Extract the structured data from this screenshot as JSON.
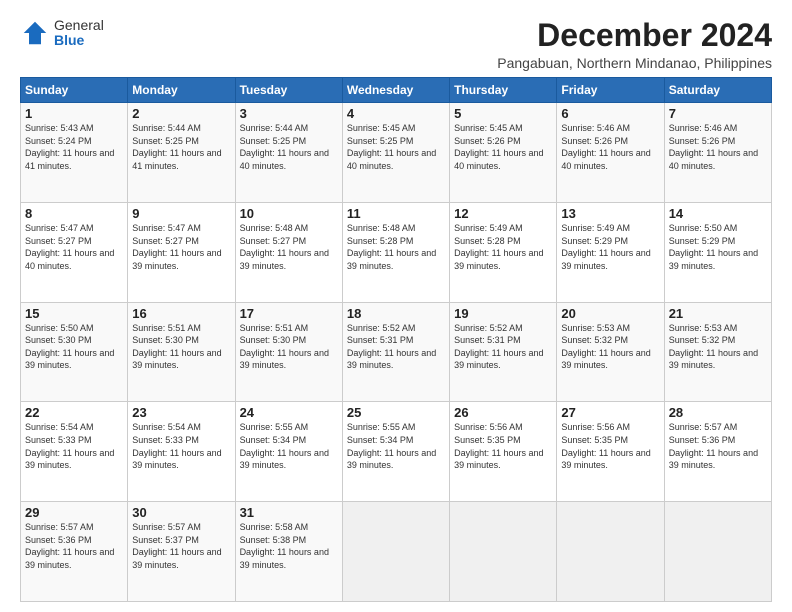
{
  "header": {
    "logo_general": "General",
    "logo_blue": "Blue",
    "main_title": "December 2024",
    "subtitle": "Pangabuan, Northern Mindanao, Philippines"
  },
  "days_of_week": [
    "Sunday",
    "Monday",
    "Tuesday",
    "Wednesday",
    "Thursday",
    "Friday",
    "Saturday"
  ],
  "weeks": [
    [
      {
        "day": "1",
        "info": "Sunrise: 5:43 AM\nSunset: 5:24 PM\nDaylight: 11 hours and 41 minutes."
      },
      {
        "day": "2",
        "info": "Sunrise: 5:44 AM\nSunset: 5:25 PM\nDaylight: 11 hours and 41 minutes."
      },
      {
        "day": "3",
        "info": "Sunrise: 5:44 AM\nSunset: 5:25 PM\nDaylight: 11 hours and 40 minutes."
      },
      {
        "day": "4",
        "info": "Sunrise: 5:45 AM\nSunset: 5:25 PM\nDaylight: 11 hours and 40 minutes."
      },
      {
        "day": "5",
        "info": "Sunrise: 5:45 AM\nSunset: 5:26 PM\nDaylight: 11 hours and 40 minutes."
      },
      {
        "day": "6",
        "info": "Sunrise: 5:46 AM\nSunset: 5:26 PM\nDaylight: 11 hours and 40 minutes."
      },
      {
        "day": "7",
        "info": "Sunrise: 5:46 AM\nSunset: 5:26 PM\nDaylight: 11 hours and 40 minutes."
      }
    ],
    [
      {
        "day": "8",
        "info": "Sunrise: 5:47 AM\nSunset: 5:27 PM\nDaylight: 11 hours and 40 minutes."
      },
      {
        "day": "9",
        "info": "Sunrise: 5:47 AM\nSunset: 5:27 PM\nDaylight: 11 hours and 39 minutes."
      },
      {
        "day": "10",
        "info": "Sunrise: 5:48 AM\nSunset: 5:27 PM\nDaylight: 11 hours and 39 minutes."
      },
      {
        "day": "11",
        "info": "Sunrise: 5:48 AM\nSunset: 5:28 PM\nDaylight: 11 hours and 39 minutes."
      },
      {
        "day": "12",
        "info": "Sunrise: 5:49 AM\nSunset: 5:28 PM\nDaylight: 11 hours and 39 minutes."
      },
      {
        "day": "13",
        "info": "Sunrise: 5:49 AM\nSunset: 5:29 PM\nDaylight: 11 hours and 39 minutes."
      },
      {
        "day": "14",
        "info": "Sunrise: 5:50 AM\nSunset: 5:29 PM\nDaylight: 11 hours and 39 minutes."
      }
    ],
    [
      {
        "day": "15",
        "info": "Sunrise: 5:50 AM\nSunset: 5:30 PM\nDaylight: 11 hours and 39 minutes."
      },
      {
        "day": "16",
        "info": "Sunrise: 5:51 AM\nSunset: 5:30 PM\nDaylight: 11 hours and 39 minutes."
      },
      {
        "day": "17",
        "info": "Sunrise: 5:51 AM\nSunset: 5:30 PM\nDaylight: 11 hours and 39 minutes."
      },
      {
        "day": "18",
        "info": "Sunrise: 5:52 AM\nSunset: 5:31 PM\nDaylight: 11 hours and 39 minutes."
      },
      {
        "day": "19",
        "info": "Sunrise: 5:52 AM\nSunset: 5:31 PM\nDaylight: 11 hours and 39 minutes."
      },
      {
        "day": "20",
        "info": "Sunrise: 5:53 AM\nSunset: 5:32 PM\nDaylight: 11 hours and 39 minutes."
      },
      {
        "day": "21",
        "info": "Sunrise: 5:53 AM\nSunset: 5:32 PM\nDaylight: 11 hours and 39 minutes."
      }
    ],
    [
      {
        "day": "22",
        "info": "Sunrise: 5:54 AM\nSunset: 5:33 PM\nDaylight: 11 hours and 39 minutes."
      },
      {
        "day": "23",
        "info": "Sunrise: 5:54 AM\nSunset: 5:33 PM\nDaylight: 11 hours and 39 minutes."
      },
      {
        "day": "24",
        "info": "Sunrise: 5:55 AM\nSunset: 5:34 PM\nDaylight: 11 hours and 39 minutes."
      },
      {
        "day": "25",
        "info": "Sunrise: 5:55 AM\nSunset: 5:34 PM\nDaylight: 11 hours and 39 minutes."
      },
      {
        "day": "26",
        "info": "Sunrise: 5:56 AM\nSunset: 5:35 PM\nDaylight: 11 hours and 39 minutes."
      },
      {
        "day": "27",
        "info": "Sunrise: 5:56 AM\nSunset: 5:35 PM\nDaylight: 11 hours and 39 minutes."
      },
      {
        "day": "28",
        "info": "Sunrise: 5:57 AM\nSunset: 5:36 PM\nDaylight: 11 hours and 39 minutes."
      }
    ],
    [
      {
        "day": "29",
        "info": "Sunrise: 5:57 AM\nSunset: 5:36 PM\nDaylight: 11 hours and 39 minutes."
      },
      {
        "day": "30",
        "info": "Sunrise: 5:57 AM\nSunset: 5:37 PM\nDaylight: 11 hours and 39 minutes."
      },
      {
        "day": "31",
        "info": "Sunrise: 5:58 AM\nSunset: 5:38 PM\nDaylight: 11 hours and 39 minutes."
      },
      {
        "day": "",
        "info": ""
      },
      {
        "day": "",
        "info": ""
      },
      {
        "day": "",
        "info": ""
      },
      {
        "day": "",
        "info": ""
      }
    ]
  ]
}
